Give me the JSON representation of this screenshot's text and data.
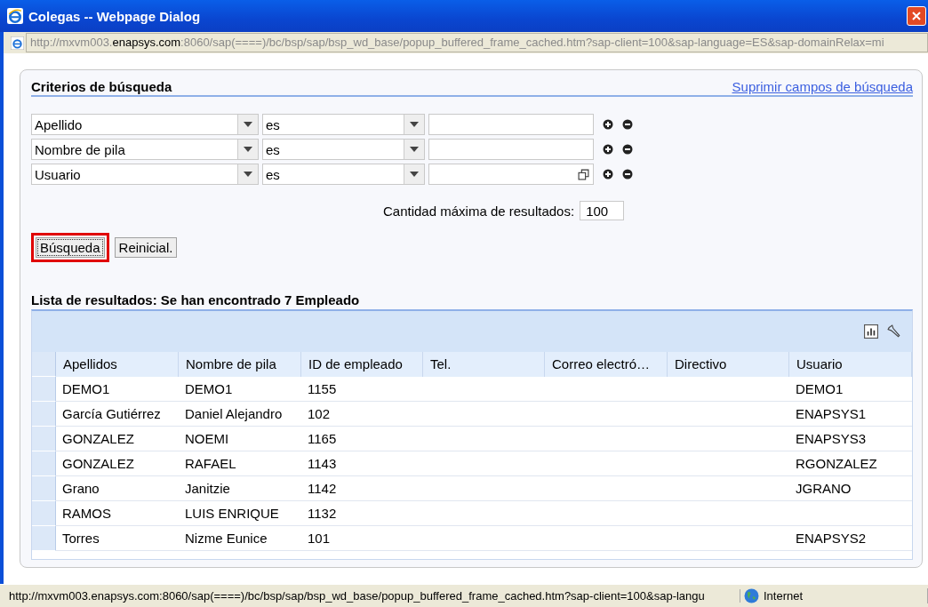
{
  "window": {
    "title": "Colegas -- Webpage Dialog"
  },
  "address": {
    "prefix": "http://mxvm003.",
    "domain": "enapsys.com",
    "suffix": ":8060/sap(====)/bc/bsp/sap/bsp_wd_base/popup_buffered_frame_cached.htm?sap-client=100&sap-language=ES&sap-domainRelax=mi"
  },
  "criteria": {
    "title": "Criterios de búsqueda",
    "link": "Suprimir campos de búsqueda",
    "rows": [
      {
        "field": "Apellido",
        "operator": "es",
        "value_help": false
      },
      {
        "field": "Nombre de pila",
        "operator": "es",
        "value_help": false
      },
      {
        "field": "Usuario",
        "operator": "es",
        "value_help": true
      }
    ],
    "max_label": "Cantidad máxima de resultados:",
    "max_value": "100",
    "buttons": [
      {
        "label": "Búsqueda",
        "highlighted": true
      },
      {
        "label": "Reinicial.",
        "highlighted": false
      }
    ]
  },
  "results": {
    "title": "Lista de resultados: Se han encontrado 7 Empleado",
    "columns": [
      "Apellidos",
      "Nombre de pila",
      "ID de empleado",
      "Tel.",
      "Correo electró…",
      "Directivo",
      "Usuario"
    ],
    "rows": [
      {
        "cells": [
          "DEMO1",
          "DEMO1",
          "1155",
          null,
          null,
          null,
          "DEMO1"
        ]
      },
      {
        "cells": [
          "García Gutiérrez",
          "Daniel Alejandro",
          "102",
          null,
          null,
          null,
          "ENAPSYS1"
        ]
      },
      {
        "cells": [
          "GONZALEZ",
          "NOEMI",
          "1165",
          null,
          null,
          null,
          "ENAPSYS3"
        ]
      },
      {
        "cells": [
          "GONZALEZ",
          "RAFAEL",
          "1143",
          null,
          null,
          null,
          "RGONZALEZ"
        ]
      },
      {
        "cells": [
          "Grano",
          "Janitzie",
          "1142",
          null,
          null,
          null,
          "JGRANO"
        ]
      },
      {
        "cells": [
          "RAMOS",
          "LUIS ENRIQUE",
          "1132",
          null,
          null,
          null,
          null
        ]
      },
      {
        "cells": [
          "Torres",
          "Nizme Eunice",
          "101",
          null,
          null,
          null,
          "ENAPSYS2"
        ]
      }
    ]
  },
  "status_bar": {
    "url": "http://mxvm003.enapsys.com:8060/sap(====)/bc/bsp/sap/bsp_wd_base/popup_buffered_frame_cached.htm?sap-client=100&sap-langu",
    "zone": "Internet"
  }
}
